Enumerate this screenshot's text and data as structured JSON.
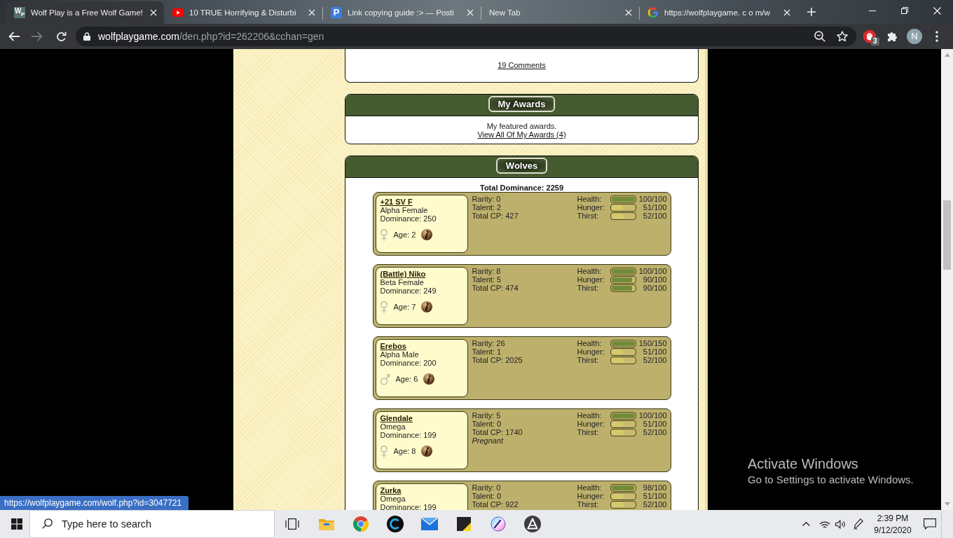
{
  "browser": {
    "tabs": [
      {
        "title": "Wolf Play is a Free Wolf Game!",
        "kind": "monogram",
        "icon_text": "W$_{P}$",
        "selected": true
      },
      {
        "title": "10 TRUE Horrifying & Disturbi",
        "kind": "play",
        "selected": false
      },
      {
        "title": "Link copying guide :> — Posti",
        "kind": "letter-badge",
        "icon_text": "P",
        "selected": false
      },
      {
        "title": "New Tab",
        "selected": false
      },
      {
        "title": "https://wolfplaygame. c o m/w",
        "kind": "ring",
        "selected": false
      }
    ],
    "forward_disabled": true,
    "address": {
      "host": "wolfplaygame.com",
      "path": "/den.php?id=262206&cchan=gen"
    },
    "extension_badge": "3",
    "profile_initial": "N"
  },
  "page": {
    "comments_link": "19 Comments",
    "awards": {
      "title": "My Awards",
      "text": "My featured awards.",
      "link": "View All Of My Awards (4)"
    },
    "wolves": {
      "title": "Wolves",
      "total": "Total Dominance: 2259",
      "items": [
        {
          "name": "+21 SV F",
          "role": "Alpha Female",
          "dominance": "Dominance: 250",
          "kind": "female",
          "age": "Age: 2",
          "rarity": "Rarity: 0",
          "talent": "Talent: 2",
          "cp": "Total CP: 427",
          "stats": [
            {
              "label": "Health:",
              "level": 1,
              "value": "100/100"
            },
            {
              "label": "Hunger:",
              "level": 0.51,
              "value": "51/100"
            },
            {
              "label": "Thirst:",
              "level": 0.52,
              "value": "52/100"
            }
          ]
        },
        {
          "name": "(Battle) Niko",
          "role": "Beta Female",
          "dominance": "Dominance: 249",
          "kind": "female",
          "age": "Age: 7",
          "rarity": "Rarity: 8",
          "talent": "Talent: 5",
          "cp": "Total CP: 474",
          "stats": [
            {
              "label": "Health:",
              "level": 1,
              "value": "100/100"
            },
            {
              "label": "Hunger:",
              "level": 0.9,
              "value": "90/100"
            },
            {
              "label": "Thirst:",
              "level": 0.9,
              "value": "90/100"
            }
          ]
        },
        {
          "name": "Erebos",
          "role": "Alpha Male",
          "dominance": "Dominance: 200",
          "kind": "male",
          "age": "Age: 6",
          "rarity": "Rarity: 26",
          "talent": "Talent: 1",
          "cp": "Total CP: 2025",
          "stats": [
            {
              "label": "Health:",
              "level": 1,
              "value": "150/150"
            },
            {
              "label": "Hunger:",
              "level": 0.51,
              "value": "51/100"
            },
            {
              "label": "Thirst:",
              "level": 0.52,
              "value": "52/100"
            }
          ]
        },
        {
          "name": "Glendale",
          "role": "Omega",
          "dominance": "Dominance: 199",
          "kind": "female",
          "age": "Age: 8",
          "rarity": "Rarity: 5",
          "talent": "Talent: 0",
          "cp": "Total CP: 1740",
          "note": "Pregnant",
          "stats": [
            {
              "label": "Health:",
              "level": 1,
              "value": "100/100"
            },
            {
              "label": "Hunger:",
              "level": 0.51,
              "value": "51/100"
            },
            {
              "label": "Thirst:",
              "level": 0.52,
              "value": "52/100"
            }
          ]
        },
        {
          "name": "Zurka",
          "role": "Omega",
          "dominance": "Dominance: 199",
          "rarity": "Rarity: 0",
          "talent": "Talent: 0",
          "cp": "Total CP: 922",
          "stats": [
            {
              "label": "Health:",
              "level": 0.98,
              "value": "98/100"
            },
            {
              "label": "Hunger:",
              "level": 0.51,
              "value": "51/100"
            },
            {
              "label": "Thirst:",
              "level": 0.52,
              "value": "52/100"
            }
          ]
        }
      ]
    }
  },
  "status_url": "https://wolfplaygame.com/wolf.php?id=3047721",
  "activation": {
    "title": "Activate Windows",
    "text": "Go to Settings to activate Windows."
  },
  "taskbar": {
    "search": {
      "placeholder": "Type here to search"
    },
    "time": "2:39 PM",
    "date": "9/12/2020"
  }
}
